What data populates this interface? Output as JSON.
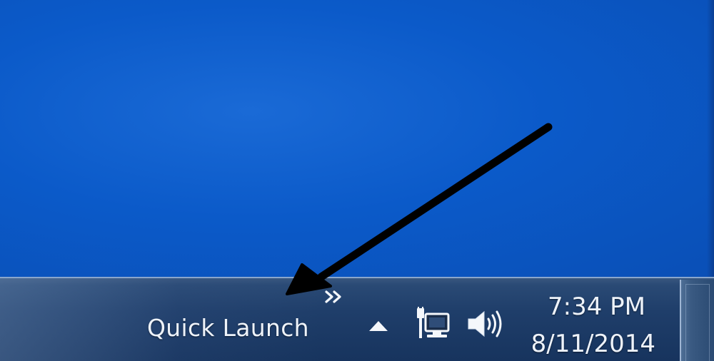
{
  "taskbar": {
    "quick_launch_label": "Quick Launch",
    "toolbar_overflow_symbol": "»",
    "tray": {
      "show_hidden_icons_symbol": "▲",
      "network_icon": "network-wired-icon",
      "volume_icon": "speaker-volume-icon"
    },
    "clock": {
      "time": "7:34 PM",
      "date": "8/11/2014"
    }
  },
  "colors": {
    "desktop_blue": "#0b5ac9",
    "taskbar_blue": "#1f3e6a",
    "annotation_arrow": "#000000"
  }
}
